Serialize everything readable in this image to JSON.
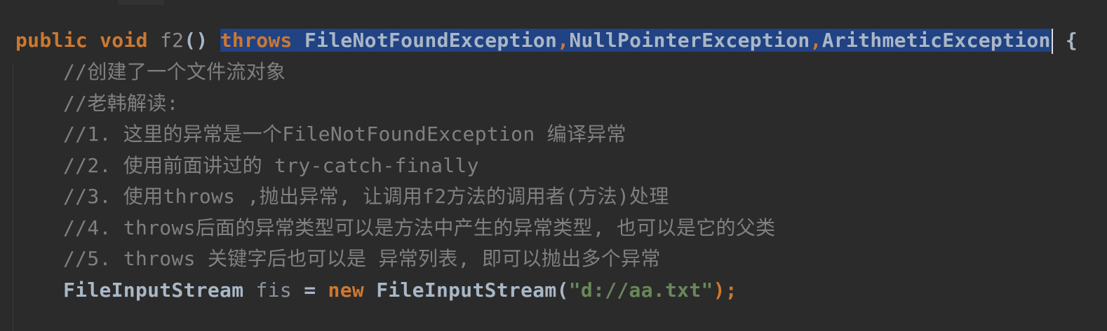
{
  "editor": {
    "theme_colors": {
      "background": "#2b2b2b",
      "keyword": "#cc7832",
      "identifier": "#a9b7c6",
      "comment": "#808080",
      "string": "#6a8759",
      "selection": "#214283"
    },
    "line1": {
      "kw_public": "public",
      "kw_void": "void",
      "method_name": "f2",
      "parens": "()",
      "kw_throws": "throws",
      "exc1": "FileNotFoundException",
      "comma1": ",",
      "exc2": "NullPointerException",
      "comma2": ",",
      "exc3": "ArithmeticException",
      "brace": "{"
    },
    "comments": [
      "//创建了一个文件流对象",
      "//老韩解读:",
      "//1. 这里的异常是一个FileNotFoundException 编译异常",
      "//2. 使用前面讲过的 try-catch-finally",
      "//3. 使用throws ,抛出异常, 让调用f2方法的调用者(方法)处理",
      "//4. throws后面的异常类型可以是方法中产生的异常类型, 也可以是它的父类",
      "//5. throws 关键字后也可以是 异常列表, 即可以抛出多个异常"
    ],
    "line9": {
      "type1": "FileInputStream",
      "var": "fis",
      "assign": "=",
      "kw_new": "new",
      "type2": "FileInputStream",
      "open_paren": "(",
      "string": "\"d://aa.txt\"",
      "close": ");"
    }
  }
}
